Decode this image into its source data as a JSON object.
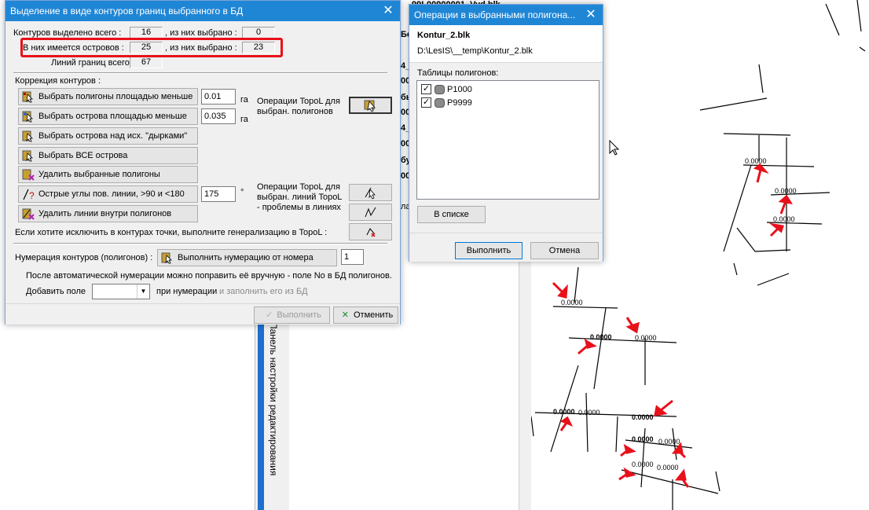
{
  "background": {
    "top_line": "R099L00900001_Vyd.blk",
    "list_fragments": [
      "Бе",
      "4_",
      "00",
      "бы",
      "00",
      "4_",
      "00",
      "бу",
      "00",
      "ла"
    ],
    "vertical_panel_text": "Панель настройки редактирования",
    "map_labels": [
      "0.0000",
      "0.0000",
      "0.0000",
      "0.0000",
      "0.0000",
      "0.0000",
      "0.0000",
      "0.0000",
      "0.0000",
      "0.0000",
      "0.0000",
      "0.0000",
      "0.0000",
      "0.0000",
      "0.0000"
    ]
  },
  "main_dialog": {
    "title": "Выделение в виде контуров границ выбранного в БД",
    "close_glyph": "✕",
    "stats": {
      "contours_label": "Контуров выделено всего :",
      "contours_value": "16",
      "contours_selected_label": ", из них выбрано :",
      "contours_selected_value": "0",
      "islands_label": "В них имеется островов :",
      "islands_value": "25",
      "islands_selected_label": ", из них выбрано :",
      "islands_selected_value": "23",
      "lines_label": "Линий границ всего :",
      "lines_value": "67"
    },
    "correction_label": "Коррекция контуров :",
    "buttons": {
      "select_small_polygons": "Выбрать полигоны площадью меньше",
      "select_small_islands": "Выбрать острова площадью меньше",
      "select_islands_over_holes": "Выбрать острова над исх. \"дырками\"",
      "select_all_islands": "Выбрать ВСЕ острова",
      "delete_selected_polygons": "Удалить выбранные полигоны",
      "sharp_angles": "Острые углы пов. линии, >90 и <180",
      "delete_lines_inside": "Удалить линии внутри полигонов",
      "numbering": "Выполнить нумерацию от номера",
      "run": "Выполнить",
      "cancel": "Отменить"
    },
    "inputs": {
      "area_polygons": "0.01",
      "area_islands": "0.035",
      "angle": "175",
      "start_number": "1",
      "add_field": ""
    },
    "units": {
      "ha1": "га",
      "ha2": "га",
      "deg": "°"
    },
    "topol_polygons_text": "Операции TopoL для выбран. полигонов",
    "topol_lines_text": "Операции TopoL для выбран. линий TopoL - проблемы в линиях",
    "generalization_text": "Если хотите исключить в контурах точки, выполните генерализацию в TopoL :",
    "numbering_label": "Нумерация контуров (полигонов) :",
    "after_numbering_text": "После автоматической нумерации можно  поправить её вручную - поле No в БД полигонов.",
    "add_field_label": "Добавить поле",
    "when_numbering_label": "при нумерации",
    "fill_from_db_label": "и заполнить его из БД"
  },
  "ops_dialog": {
    "title": "Операции в выбранными полигона...",
    "close_glyph": "✕",
    "file_name": "Kontur_2.blk",
    "file_path": "D:\\LesIS\\__temp\\Kontur_2.blk",
    "tables_label": "Таблицы полигонов:",
    "tables": [
      {
        "name": "P1000",
        "checked": true
      },
      {
        "name": "P9999",
        "checked": true
      }
    ],
    "in_list_button": "В списке",
    "run_button": "Выполнить",
    "cancel_button": "Отмена"
  },
  "colors": {
    "titlebar": "#1f86d6",
    "highlight": "#e8101a",
    "arrow": "#e8101a"
  }
}
